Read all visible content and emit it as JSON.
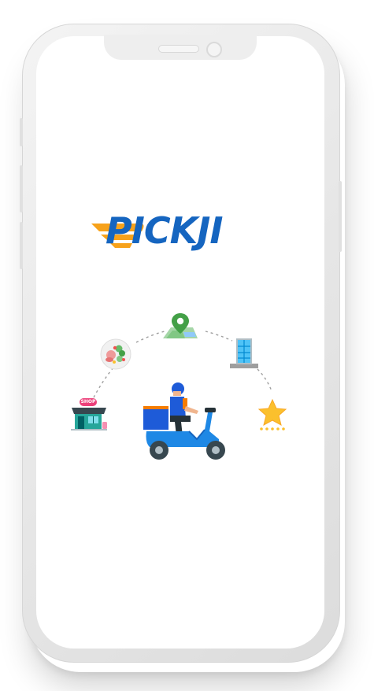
{
  "brand": {
    "name": "PICKJI",
    "color_primary": "#1565c0",
    "color_accent": "#f7a21b"
  },
  "illustration": {
    "shop_sign": "SHOP",
    "icons": [
      "shop-icon",
      "food-salad-icon",
      "map-pin-icon",
      "building-icon",
      "star-rating-icon",
      "delivery-scooter-icon"
    ]
  }
}
